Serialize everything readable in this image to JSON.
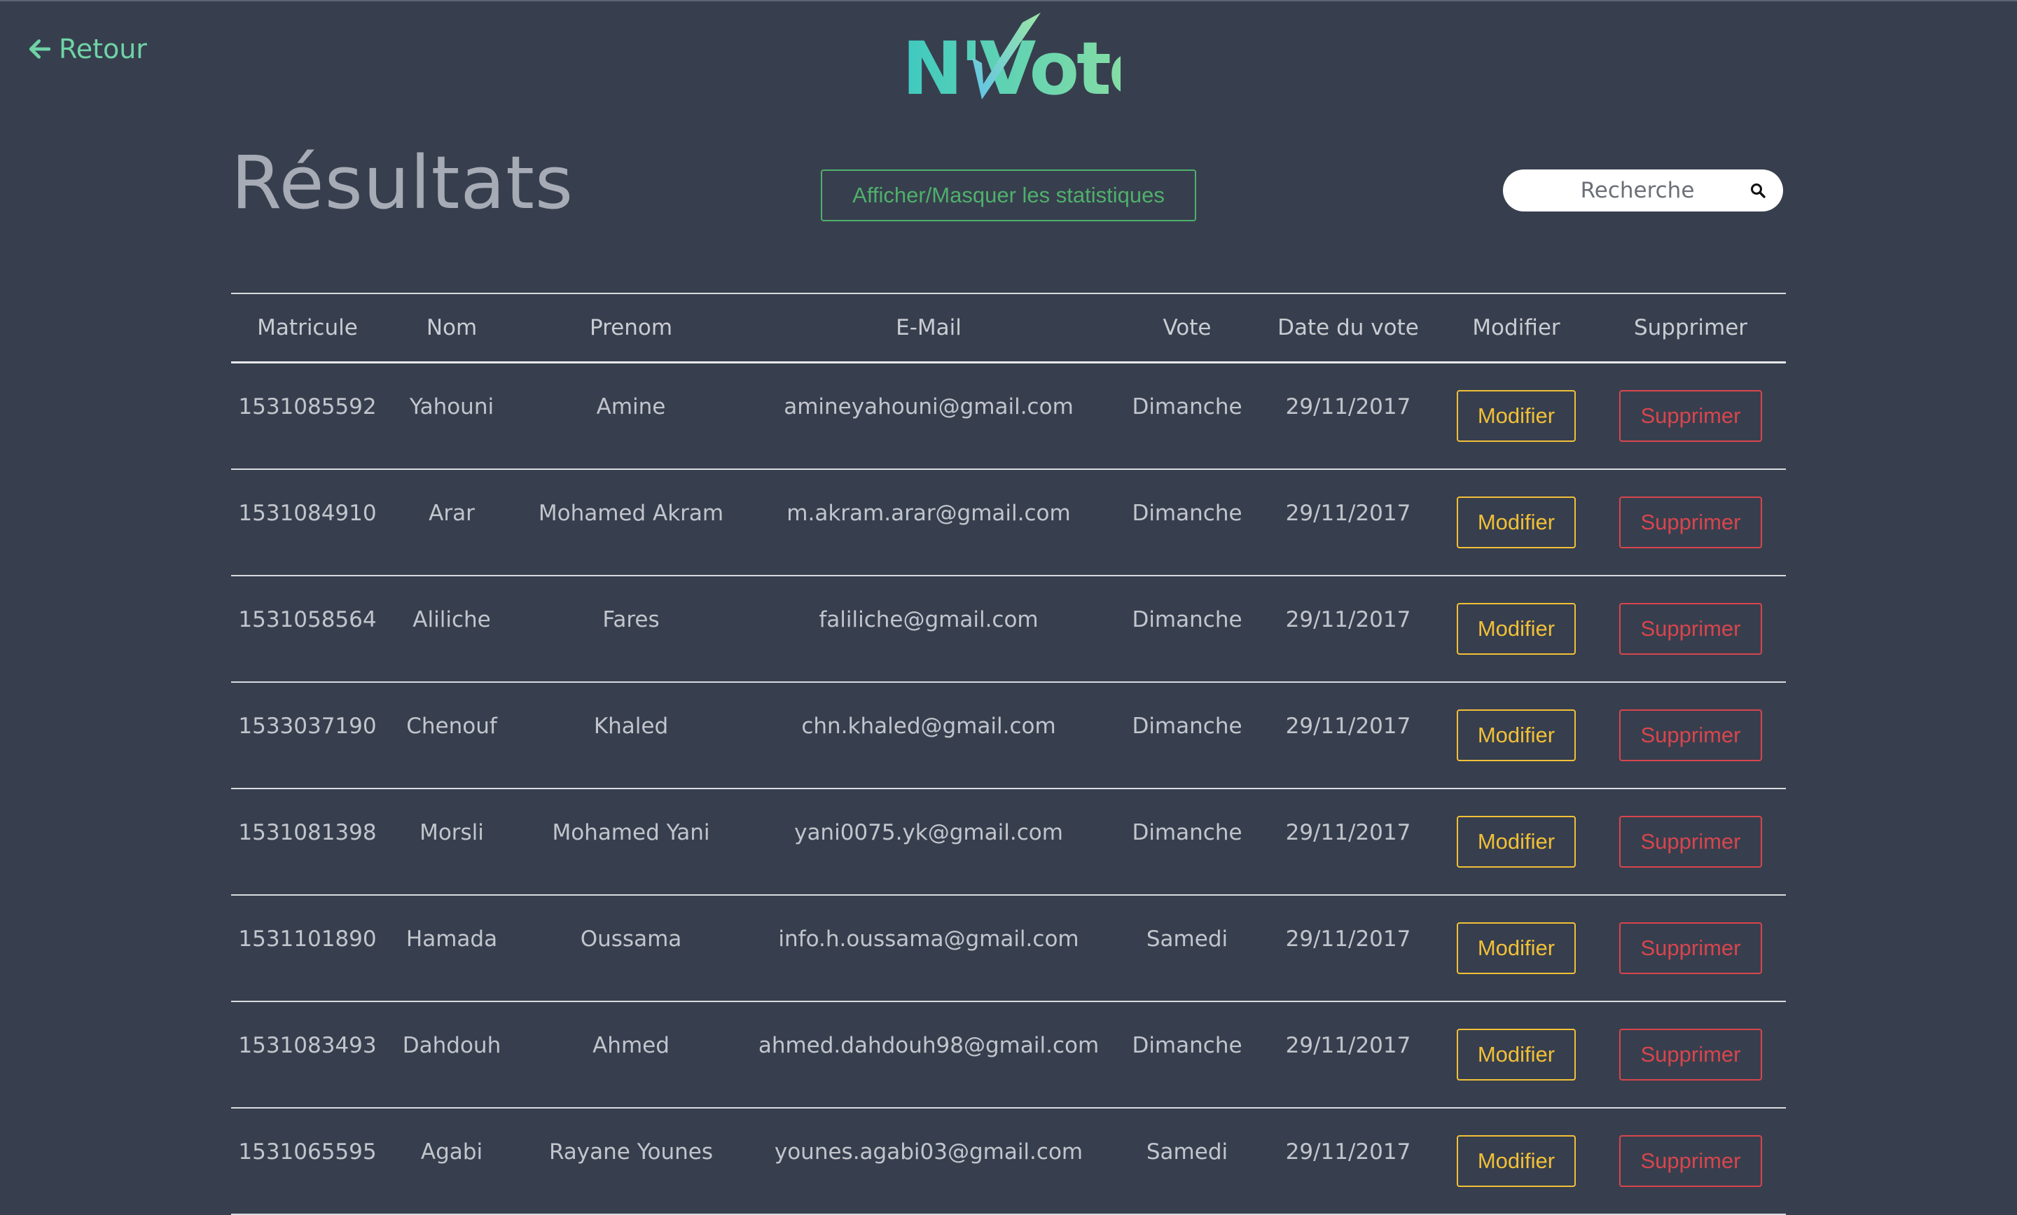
{
  "nav": {
    "back_label": "Retour"
  },
  "logo": {
    "text": "N'Voté"
  },
  "page": {
    "title": "Résultats"
  },
  "toolbar": {
    "stats_toggle_label": "Afficher/Masquer les statistiques"
  },
  "search": {
    "placeholder": "Recherche"
  },
  "table": {
    "columns": [
      "Matricule",
      "Nom",
      "Prenom",
      "E-Mail",
      "Vote",
      "Date du vote",
      "Modifier",
      "Supprimer"
    ],
    "modify_label": "Modifier",
    "delete_label": "Supprimer",
    "rows": [
      [
        "1531085592",
        "Yahouni",
        "Amine",
        "amineyahouni@gmail.com",
        "Dimanche",
        "29/11/2017"
      ],
      [
        "1531084910",
        "Arar",
        "Mohamed Akram",
        "m.akram.arar@gmail.com",
        "Dimanche",
        "29/11/2017"
      ],
      [
        "1531058564",
        "Aliliche",
        "Fares",
        "faliliche@gmail.com",
        "Dimanche",
        "29/11/2017"
      ],
      [
        "1533037190",
        "Chenouf",
        "Khaled",
        "chn.khaled@gmail.com",
        "Dimanche",
        "29/11/2017"
      ],
      [
        "1531081398",
        "Morsli",
        "Mohamed Yani",
        "yani0075.yk@gmail.com",
        "Dimanche",
        "29/11/2017"
      ],
      [
        "1531101890",
        "Hamada",
        "Oussama",
        "info.h.oussama@gmail.com",
        "Samedi",
        "29/11/2017"
      ],
      [
        "1531083493",
        "Dahdouh",
        "Ahmed",
        "ahmed.dahdouh98@gmail.com",
        "Dimanche",
        "29/11/2017"
      ],
      [
        "1531065595",
        "Agabi",
        "Rayane Younes",
        "younes.agabi03@gmail.com",
        "Samedi",
        "29/11/2017"
      ]
    ]
  },
  "colors": {
    "background": "#373f4e",
    "accent_green": "#4fb06b",
    "back_link": "#6fd3a6",
    "modify": "#f2c037",
    "delete": "#d9454d"
  },
  "icons": {
    "back": "arrow-left-icon",
    "search": "search-icon"
  }
}
